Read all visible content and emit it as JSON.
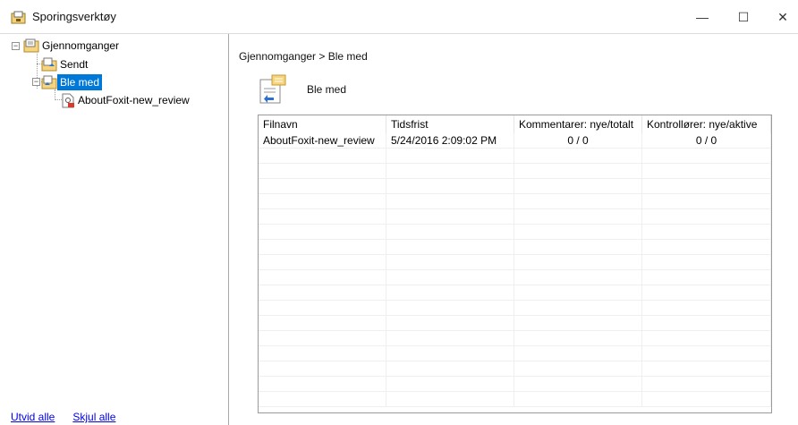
{
  "window": {
    "title": "Sporingsverktøy",
    "minimize_glyph": "—",
    "maximize_glyph": "☐",
    "close_glyph": "✕"
  },
  "tree": {
    "root": {
      "label": "Gjennomganger",
      "expander": "⊟",
      "icon": "folder-list-icon"
    },
    "children": [
      {
        "label": "Sendt",
        "icon": "sent-documents-icon"
      },
      {
        "label": "Ble med",
        "icon": "joined-documents-icon",
        "selected": true,
        "expander": "⊟",
        "children": [
          {
            "label": "AboutFoxit-new_review",
            "icon": "pdf-review-icon"
          }
        ]
      }
    ]
  },
  "footer": {
    "expand_all": "Utvid alle",
    "collapse_all": "Skjul alle"
  },
  "main": {
    "breadcrumb": "Gjennomganger > Ble med",
    "header_label": "Ble med",
    "columns": [
      "Filnavn",
      "Tidsfrist",
      "Kommentarer: nye/totalt",
      "Kontrollører: nye/aktive"
    ],
    "rows": [
      [
        "AboutFoxit-new_review",
        "5/24/2016 2:09:02 PM",
        "0 / 0",
        "0 / 0"
      ]
    ],
    "empty_row_count": 17
  },
  "colors": {
    "selection": "#0078d7",
    "link": "#0000ee"
  }
}
